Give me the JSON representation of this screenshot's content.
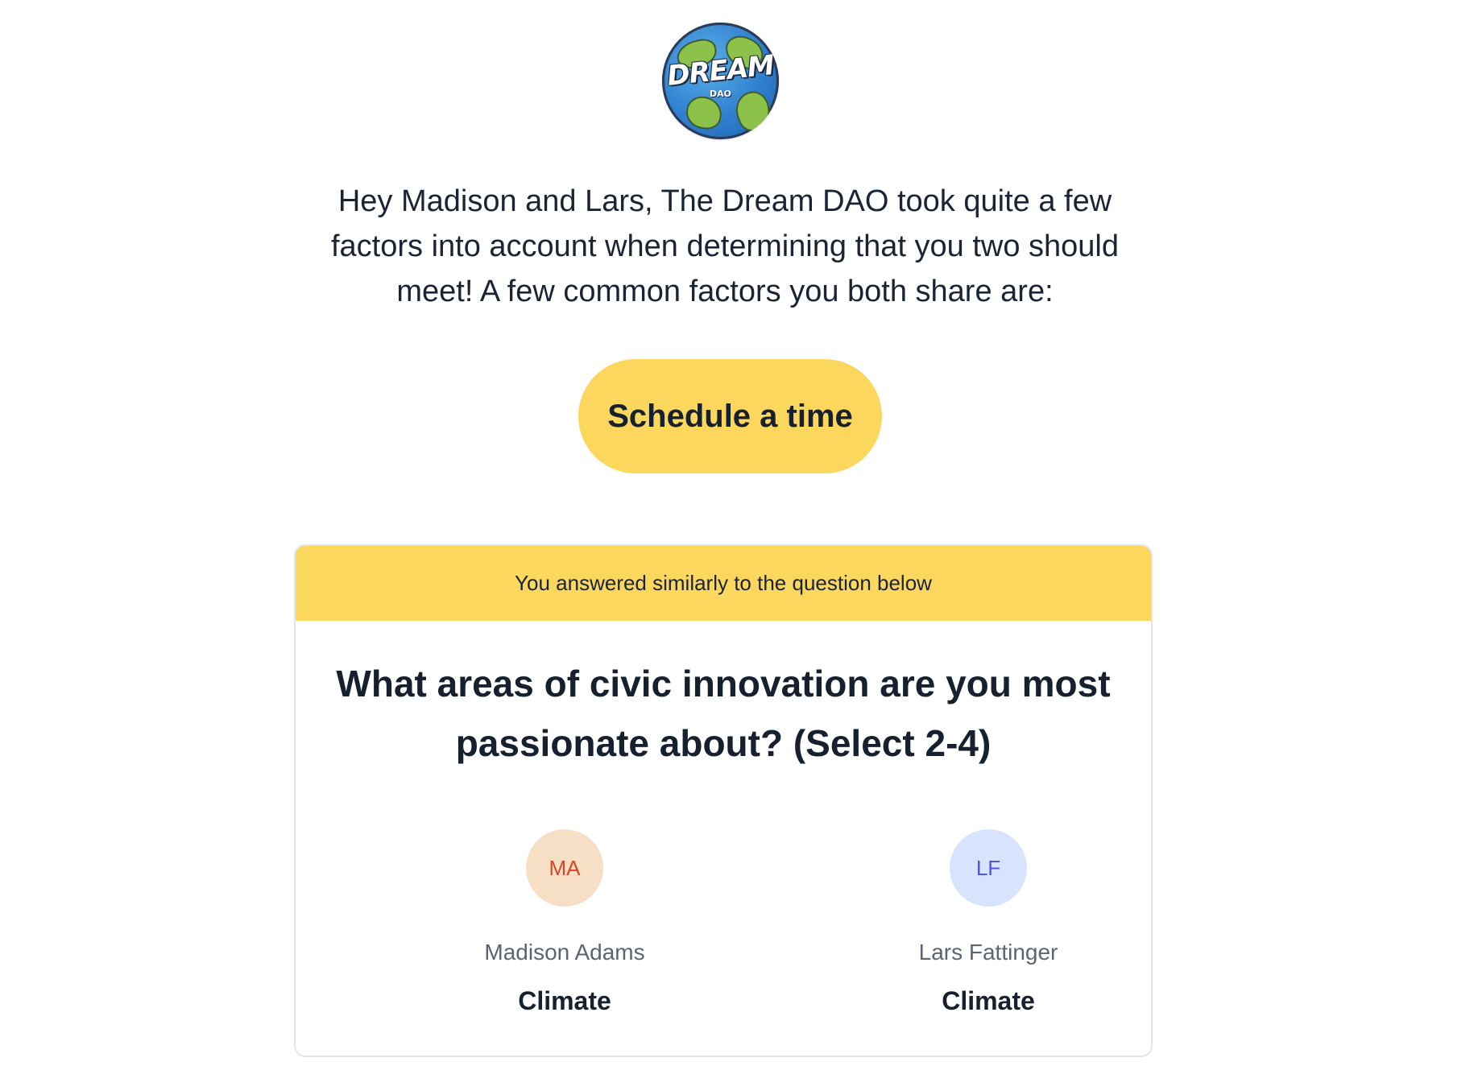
{
  "logo": {
    "word": "DREAM",
    "sub": "DAO"
  },
  "intro": "Hey Madison and Lars, The Dream DAO took quite a few factors into account when determining that you two should meet! A few common factors you both share are:",
  "cta": {
    "label": "Schedule a time"
  },
  "card": {
    "header": "You answered similarly to the question below",
    "question": "What areas of civic innovation are you most passionate about? (Select 2-4)",
    "people": [
      {
        "initials": "MA",
        "name": "Madison Adams",
        "answer": "Climate"
      },
      {
        "initials": "LF",
        "name": "Lars Fattinger",
        "answer": "Climate"
      }
    ]
  },
  "colors": {
    "accent": "#fcd75e",
    "text": "#17202e",
    "muted": "#5b6475",
    "avatar_ma_bg": "#f7dfc6",
    "avatar_ma_fg": "#d6462a",
    "avatar_lf_bg": "#d8e3fd",
    "avatar_lf_fg": "#4b58d8"
  }
}
